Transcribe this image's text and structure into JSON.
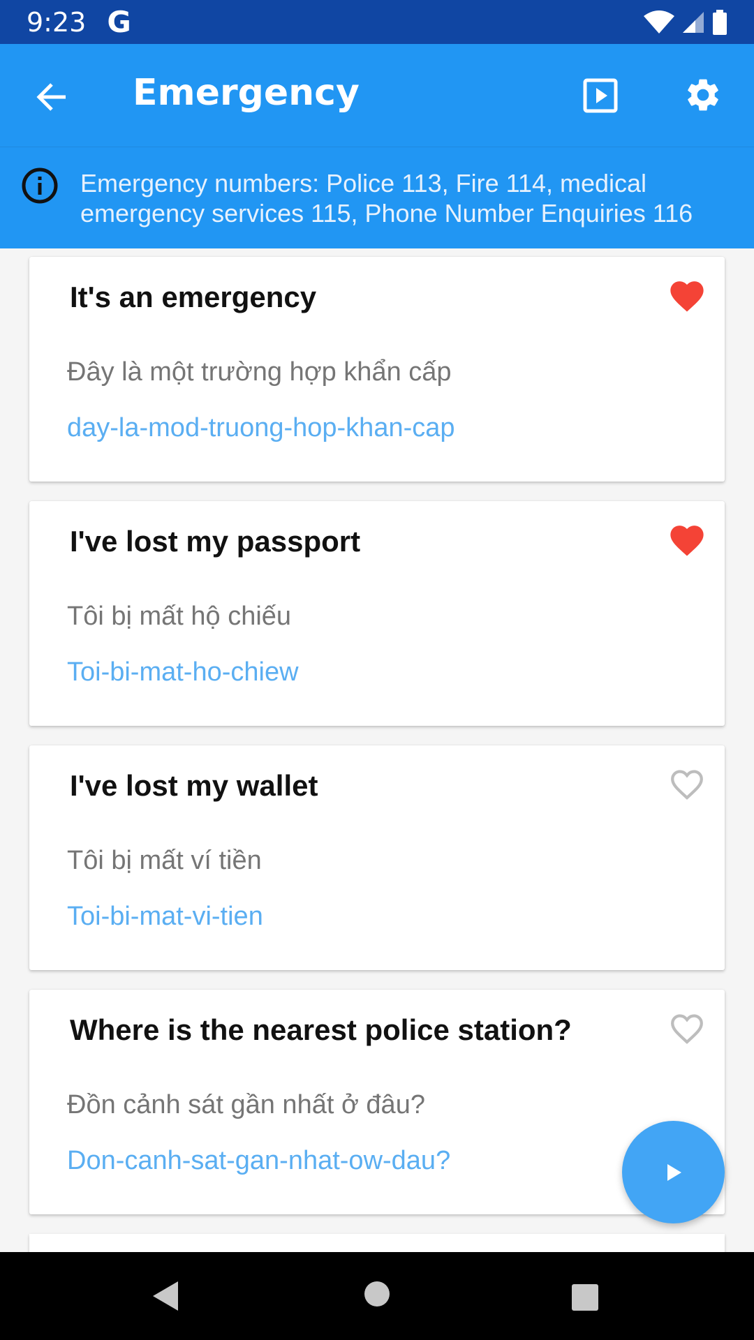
{
  "status_bar": {
    "time": "9:23",
    "g_label": "G"
  },
  "app_bar": {
    "title": "Emergency",
    "icons": [
      "arrow-back-icon",
      "play-box-icon",
      "gear-icon"
    ]
  },
  "info_banner": {
    "text": "Emergency numbers: Police 113, Fire 114, medical emergency services 115, Phone Number Enquiries 116"
  },
  "phrases": [
    {
      "english": "It's an emergency",
      "vietnamese": "Đây là một trường hợp khẩn cấp",
      "phonetic": "day-la-mod-truong-hop-khan-cap",
      "favorite": true
    },
    {
      "english": "I've lost my passport",
      "vietnamese": "Tôi bị mất hộ chiếu",
      "phonetic": "Toi-bi-mat-ho-chiew",
      "favorite": true
    },
    {
      "english": "I've lost my wallet",
      "vietnamese": "Tôi bị mất ví tiền",
      "phonetic": "Toi-bi-mat-vi-tien",
      "favorite": false
    },
    {
      "english": "Where is the nearest police station?",
      "vietnamese": "Đồn cảnh sát gần nhất ở đâu?",
      "phonetic": "Don-canh-sat-gan-nhat-ow-dau?",
      "favorite": false
    }
  ],
  "colors": {
    "status_bar": "#1046a3",
    "app_bar": "#2196f3",
    "heart_filled": "#f44336",
    "heart_outline": "#bdbdbd",
    "phonetic_text": "#5aaef2",
    "fab": "#42a5f5"
  }
}
